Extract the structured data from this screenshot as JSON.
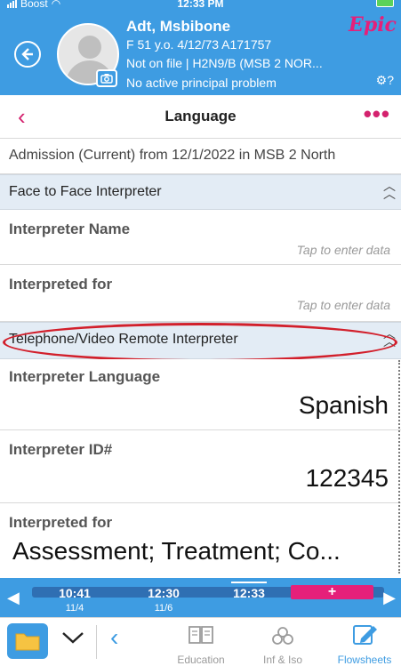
{
  "status_bar": {
    "carrier": "Boost",
    "time": "12:33 PM"
  },
  "header": {
    "patient_name": "Adt, Msbibone",
    "demographics": "F 51 y.o. 4/12/73 A171757",
    "coverage": "Not on file | H2N9/B (MSB 2 NOR...",
    "problem": "No active principal problem",
    "logo": "Epic"
  },
  "nav": {
    "title": "Language",
    "more": "•••"
  },
  "admission": "Admission (Current) from 12/1/2022 in MSB 2 North",
  "sections": {
    "face_to_face": "Face to Face Interpreter",
    "telephone": "Telephone/Video Remote Interpreter"
  },
  "fields": {
    "interpreter_name": {
      "label": "Interpreter Name",
      "hint": "Tap to enter data"
    },
    "interpreted_for_1": {
      "label": "Interpreted for",
      "hint": "Tap to enter data"
    },
    "interpreter_language": {
      "label": "Interpreter Language",
      "value": "Spanish"
    },
    "interpreter_id": {
      "label": "Interpreter ID#",
      "value": "122345"
    },
    "interpreted_for_2": {
      "label": "Interpreted for",
      "value": "Assessment; Treatment; Co..."
    }
  },
  "timeline": {
    "slots": [
      {
        "time": "10:41",
        "date": "11/4"
      },
      {
        "time": "12:30",
        "date": "11/6"
      },
      {
        "time": "12:33",
        "date": ""
      }
    ],
    "add": "+"
  },
  "tabs": {
    "education": "Education",
    "inf_iso": "Inf & Iso",
    "flowsheets": "Flowsheets"
  },
  "colors": {
    "header_blue": "#3e9ce2",
    "accent_pink": "#d4226e",
    "annotation_red": "#d21f2b"
  }
}
